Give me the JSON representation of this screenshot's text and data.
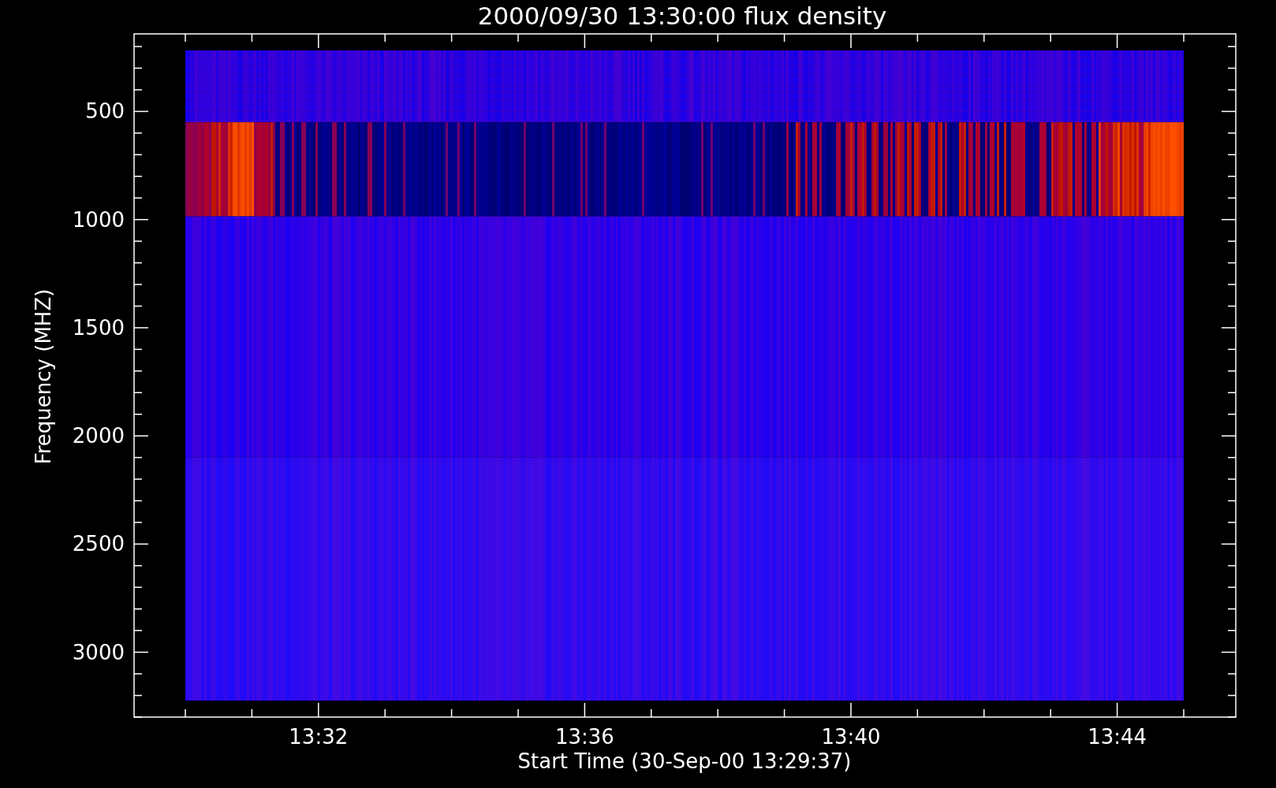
{
  "title": "2000/09/30 13:30:00 flux density",
  "ylabel": "Frequency (MHZ)",
  "xlabel": "Start Time (30-Sep-00 13:29:37)",
  "yticks": [
    "500",
    "1000",
    "1500",
    "2000",
    "2500",
    "3000"
  ],
  "xticks": [
    "13:32",
    "13:36",
    "13:40",
    "13:44"
  ]
}
